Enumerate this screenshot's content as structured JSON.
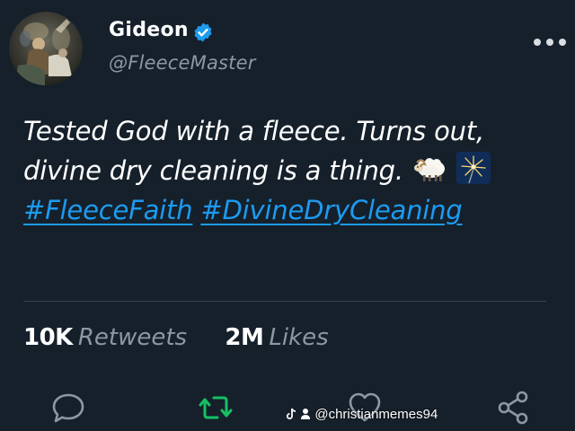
{
  "tweet": {
    "author": {
      "display_name": "Gideon",
      "handle": "@FleeceMaster",
      "verified": true,
      "avatar": "painting-avatar"
    },
    "text": {
      "line1": "Tested God with a fleece. Turns out,",
      "line2": "divine dry cleaning is a thing.",
      "emojis": [
        "ram-emoji",
        "sparkler-emoji"
      ],
      "hashtags": [
        "#FleeceFaith",
        "#DivineDryCleaning"
      ]
    },
    "stats": {
      "retweets_count": "10K",
      "retweets_label": "Retweets",
      "likes_count": "2M",
      "likes_label": "Likes"
    },
    "actions": [
      "reply-icon",
      "retweet-icon",
      "like-icon",
      "share-icon"
    ],
    "more_icon": "more-icon"
  },
  "watermark": {
    "text": "@christianmemes94",
    "icons": [
      "tiktok-icon",
      "user-icon"
    ]
  },
  "colors": {
    "background": "#15202b",
    "accent": "#1d9bf0",
    "secondary_text": "#8b98a5",
    "retweet_green": "#17bf63",
    "divider": "#38444d"
  }
}
